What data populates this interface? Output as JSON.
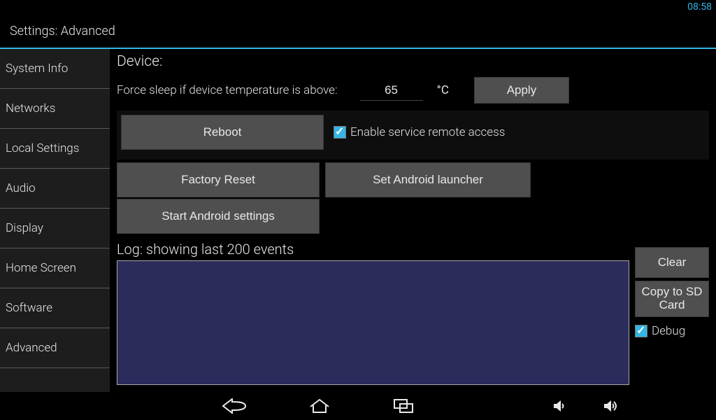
{
  "statusbar": {
    "time": "08:58"
  },
  "title": "Settings: Advanced",
  "sidebar": {
    "items": [
      {
        "label": "System Info"
      },
      {
        "label": "Networks"
      },
      {
        "label": "Local Settings"
      },
      {
        "label": "Audio"
      },
      {
        "label": "Display"
      },
      {
        "label": "Home Screen"
      },
      {
        "label": "Software"
      },
      {
        "label": "Advanced"
      }
    ]
  },
  "device": {
    "heading": "Device:",
    "temp_label": "Force sleep if device temperature is above:",
    "temp_value": "65",
    "unit": "°C",
    "apply": "Apply",
    "reboot": "Reboot",
    "remote_access_label": "Enable service remote access",
    "remote_access_checked": true,
    "factory_reset": "Factory Reset",
    "set_launcher": "Set Android launcher",
    "start_settings": "Start Android settings"
  },
  "log": {
    "heading": "Log: showing last 200 events",
    "clear": "Clear",
    "copy_sd": "Copy to SD Card",
    "debug_label": "Debug",
    "debug_checked": true
  }
}
